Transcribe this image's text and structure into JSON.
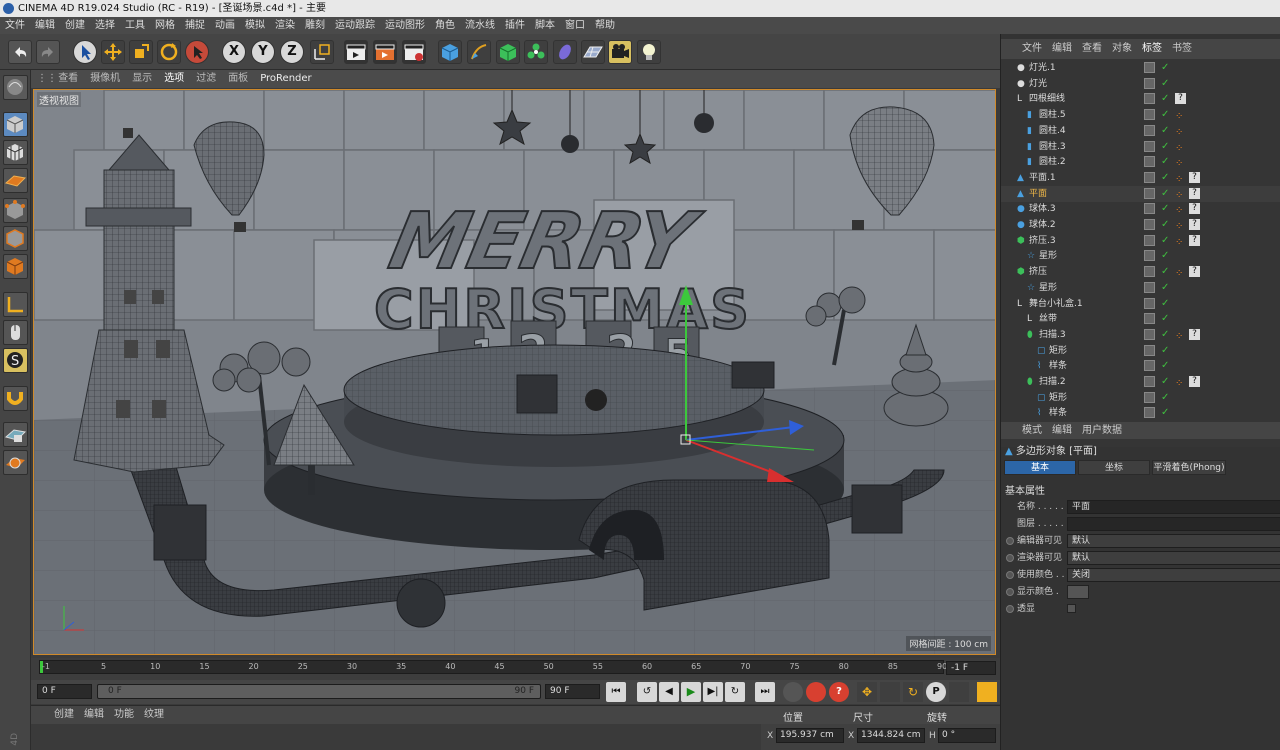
{
  "window": {
    "title": "CINEMA 4D R19.024 Studio (RC - R19) - [圣诞场景.c4d *] - 主要"
  },
  "menu": [
    "文件",
    "编辑",
    "创建",
    "选择",
    "工具",
    "网格",
    "捕捉",
    "动画",
    "模拟",
    "渲染",
    "雕刻",
    "运动跟踪",
    "运动图形",
    "角色",
    "流水线",
    "插件",
    "脚本",
    "窗口",
    "帮助"
  ],
  "toolbar": {
    "axis_x": "X",
    "axis_y": "Y",
    "axis_z": "Z"
  },
  "viewport_menu": {
    "items": [
      "查看",
      "摄像机",
      "显示",
      "选项",
      "过滤",
      "面板"
    ],
    "active": "选项",
    "renderer": "ProRender"
  },
  "viewport": {
    "label": "透视视图",
    "grid_spacing": "网格间距 : 100 cm",
    "scene_text": {
      "line1": "MERRY",
      "line2": "CHRISTMAS",
      "digits": [
        "1",
        "2",
        "2",
        "5"
      ]
    }
  },
  "timeline": {
    "ticks": [
      "-1",
      "5",
      "10",
      "15",
      "20",
      "25",
      "30",
      "35",
      "40",
      "45",
      "50",
      "55",
      "60",
      "65",
      "70",
      "75",
      "80",
      "85",
      "90"
    ],
    "end_field": "-1 F"
  },
  "transport": {
    "current": "0 F",
    "range_start": "0 F",
    "range_end": "90 F",
    "end_frame": "90 F"
  },
  "material_panel": {
    "menu": [
      "创建",
      "编辑",
      "功能",
      "纹理"
    ]
  },
  "coord_panel": {
    "headers": [
      "位置",
      "尺寸",
      "旋转"
    ],
    "x_pos": "195.937 cm",
    "x_size": "1344.824 cm",
    "h_rot": "0 °",
    "x_label": "X",
    "size_label": "X",
    "rot_label": "H"
  },
  "object_manager": {
    "menu": [
      "文件",
      "编辑",
      "查看",
      "对象",
      "标签",
      "书签"
    ],
    "active_menu": "标签",
    "rows": [
      {
        "name": "灯光.1",
        "indent": 0,
        "icon": "light"
      },
      {
        "name": "灯光",
        "indent": 0,
        "icon": "light"
      },
      {
        "name": "四根细线",
        "indent": 0,
        "icon": "null"
      },
      {
        "name": "圆柱.5",
        "indent": 1,
        "icon": "cylinder"
      },
      {
        "name": "圆柱.4",
        "indent": 1,
        "icon": "cylinder"
      },
      {
        "name": "圆柱.3",
        "indent": 1,
        "icon": "cylinder"
      },
      {
        "name": "圆柱.2",
        "indent": 1,
        "icon": "cylinder"
      },
      {
        "name": "平面.1",
        "indent": 0,
        "icon": "plane"
      },
      {
        "name": "平面",
        "indent": 0,
        "icon": "plane",
        "selected": true
      },
      {
        "name": "球体.3",
        "indent": 0,
        "icon": "sphere"
      },
      {
        "name": "球体.2",
        "indent": 0,
        "icon": "sphere"
      },
      {
        "name": "挤压.3",
        "indent": 0,
        "icon": "extrude"
      },
      {
        "name": "星形",
        "indent": 1,
        "icon": "star"
      },
      {
        "name": "挤压",
        "indent": 0,
        "icon": "extrude"
      },
      {
        "name": "星形",
        "indent": 1,
        "icon": "star"
      },
      {
        "name": "舞台小礼盒.1",
        "indent": 0,
        "icon": "null"
      },
      {
        "name": "丝带",
        "indent": 1,
        "icon": "null"
      },
      {
        "name": "扫描.3",
        "indent": 1,
        "icon": "sweep"
      },
      {
        "name": "矩形",
        "indent": 2,
        "icon": "rect"
      },
      {
        "name": "样条",
        "indent": 2,
        "icon": "spline"
      },
      {
        "name": "扫描.2",
        "indent": 1,
        "icon": "sweep"
      },
      {
        "name": "矩形",
        "indent": 2,
        "icon": "rect"
      },
      {
        "name": "样条",
        "indent": 2,
        "icon": "spline"
      }
    ]
  },
  "attribute_manager": {
    "menu": [
      "模式",
      "编辑",
      "用户数据"
    ],
    "title": "多边形对象 [平面]",
    "tabs": [
      "基本",
      "坐标",
      "平滑着色(Phong)"
    ],
    "active_tab": "基本",
    "section": "基本属性",
    "fields": [
      {
        "label": "名称 . . . . .",
        "value": "平面",
        "type": "text"
      },
      {
        "label": "图层 . . . . .",
        "value": "",
        "type": "text"
      },
      {
        "label": "编辑器可见",
        "value": "默认",
        "type": "drop",
        "radio": true
      },
      {
        "label": "渲染器可见",
        "value": "默认",
        "type": "drop",
        "radio": true
      },
      {
        "label": "使用颜色 . .",
        "value": "关闭",
        "type": "drop",
        "radio": true
      },
      {
        "label": "显示颜色 .",
        "value": "",
        "type": "swatch",
        "radio": true
      },
      {
        "label": "透显",
        "value": "",
        "type": "check",
        "radio": true
      }
    ]
  },
  "colors": {
    "accent": "#d08a2a",
    "selected": "#f0b848",
    "check": "#3fbf3f",
    "tab_active": "#2c66a8"
  }
}
